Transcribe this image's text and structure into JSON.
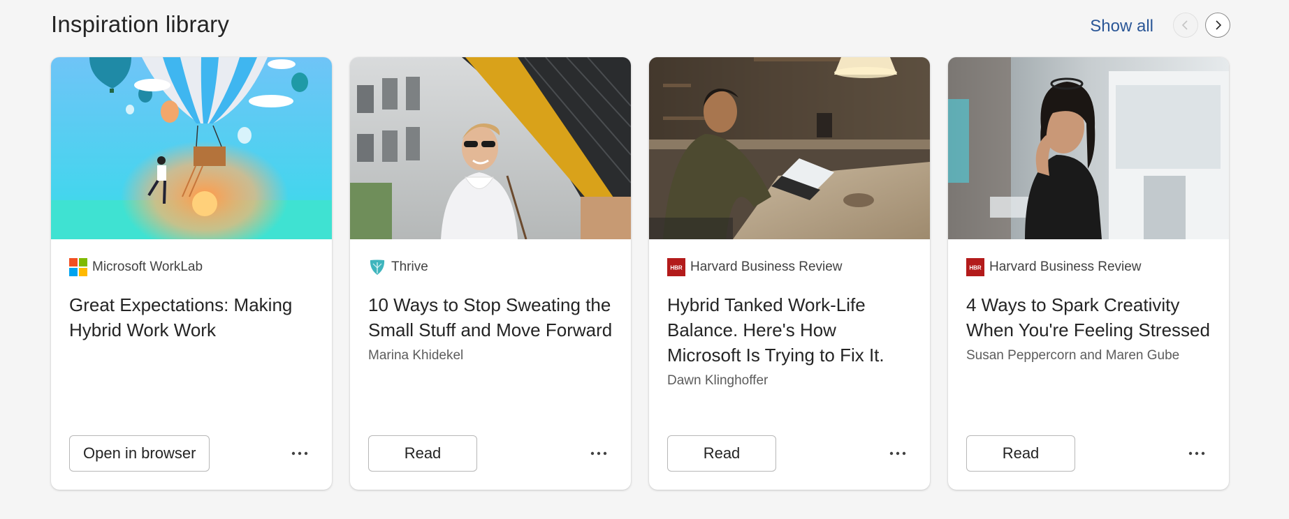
{
  "header": {
    "title": "Inspiration library",
    "show_all": "Show all"
  },
  "cards": [
    {
      "source": "Microsoft WorkLab",
      "source_icon": "microsoft-logo",
      "title": "Great Expectations: Making Hybrid Work Work",
      "author": "",
      "button": "Open in browser"
    },
    {
      "source": "Thrive",
      "source_icon": "thrive-logo",
      "title": "10 Ways to Stop Sweating the Small Stuff and Move Forward",
      "author": "Marina Khidekel",
      "button": "Read"
    },
    {
      "source": "Harvard Business Review",
      "source_icon": "hbr-logo",
      "title": "Hybrid Tanked Work-Life Balance. Here's How Microsoft Is Trying to Fix It.",
      "author": "Dawn Klinghoffer",
      "button": "Read"
    },
    {
      "source": "Harvard Business Review",
      "source_icon": "hbr-logo",
      "title": "4 Ways to Spark Creativity When You're Feeling Stressed",
      "author": "Susan Peppercorn and Maren Gube",
      "button": "Read"
    }
  ],
  "colors": {
    "link": "#2b5797",
    "hbr_red": "#b31b1b",
    "thrive_teal": "#3fb5bd"
  }
}
